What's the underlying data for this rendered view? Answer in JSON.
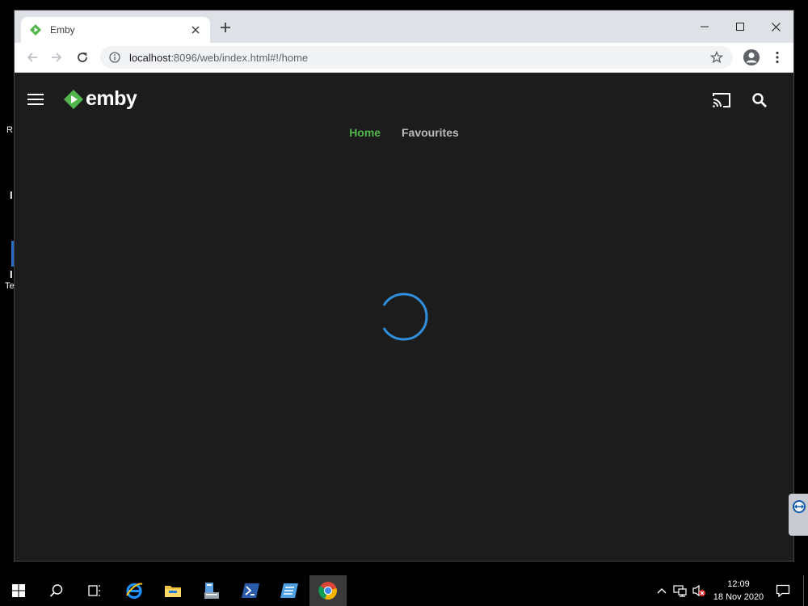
{
  "browser": {
    "tab_title": "Emby",
    "url_host": "localhost",
    "url_rest": ":8096/web/index.html#!/home",
    "window_controls": [
      "minimize-icon",
      "maximize-icon",
      "close-icon"
    ]
  },
  "app": {
    "logo_text": "emby",
    "nav_tabs": [
      {
        "label": "Home",
        "active": true
      },
      {
        "label": "Favourites",
        "active": false
      }
    ],
    "accent_color": "#52b54b",
    "spinner_color": "#2f8fdc",
    "background_color": "#1c1c1c"
  },
  "desktop": {
    "fragments": [
      "R",
      "I",
      "I",
      "Te"
    ]
  },
  "taskbar": {
    "apps": [
      "start-icon",
      "search-icon",
      "task-view-icon",
      "internet-explorer-icon",
      "file-explorer-icon",
      "server-manager-icon",
      "powershell-icon",
      "app-icon",
      "chrome-icon"
    ],
    "clock_time": "12:09",
    "clock_date": "18 Nov 2020"
  }
}
